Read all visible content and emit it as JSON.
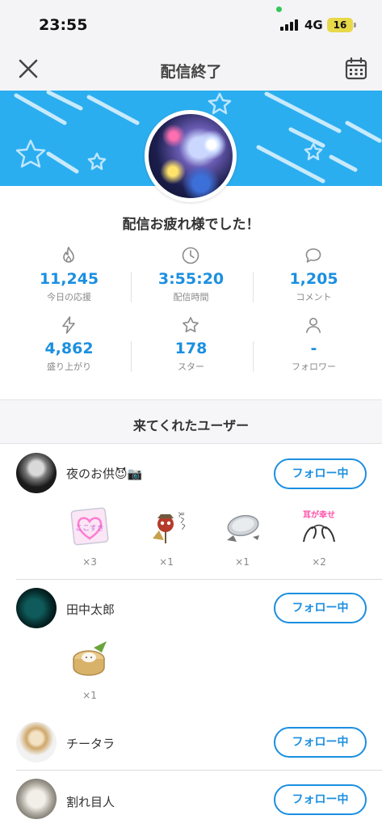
{
  "status_bar": {
    "time": "23:55",
    "network": "4G",
    "battery": "16"
  },
  "header": {
    "title": "配信終了"
  },
  "summary": {
    "message": "配信お疲れ様でした！"
  },
  "stats": [
    {
      "icon": "flame-icon",
      "value": "11,245",
      "label": "今日の応援"
    },
    {
      "icon": "clock-icon",
      "value": "3:55:20",
      "label": "配信時間"
    },
    {
      "icon": "comment-bubble-icon",
      "value": "1,205",
      "label": "コメント"
    },
    {
      "icon": "lightning-icon",
      "value": "4,862",
      "label": "盛り上がり"
    },
    {
      "icon": "star-icon",
      "value": "178",
      "label": "スター"
    },
    {
      "icon": "person-icon",
      "value": "-",
      "label": "フォロワー"
    }
  ],
  "visitors": {
    "title": "来てくれたユーザー",
    "follow_label": "フォロー中",
    "users": [
      {
        "name": "夜のお供😈📷",
        "gifts": [
          {
            "icon": "heart-sticker-gift",
            "text": "ここすき",
            "count": "×3"
          },
          {
            "icon": "scarecrow-gift",
            "text": "えへへ",
            "count": "×1"
          },
          {
            "icon": "metal-tray-gift",
            "count": "×1"
          },
          {
            "icon": "ears-happiness-gift",
            "text": "耳が幸せ",
            "count": "×2"
          }
        ]
      },
      {
        "name": "田中太郎",
        "gifts": [
          {
            "icon": "dumpling-steamer-gift",
            "count": "×1"
          }
        ]
      },
      {
        "name": "チータラ",
        "gifts": []
      },
      {
        "name": "割れ目人",
        "gifts": []
      }
    ]
  },
  "colors": {
    "accent": "#1b8fe0",
    "banner": "#2baeef"
  }
}
